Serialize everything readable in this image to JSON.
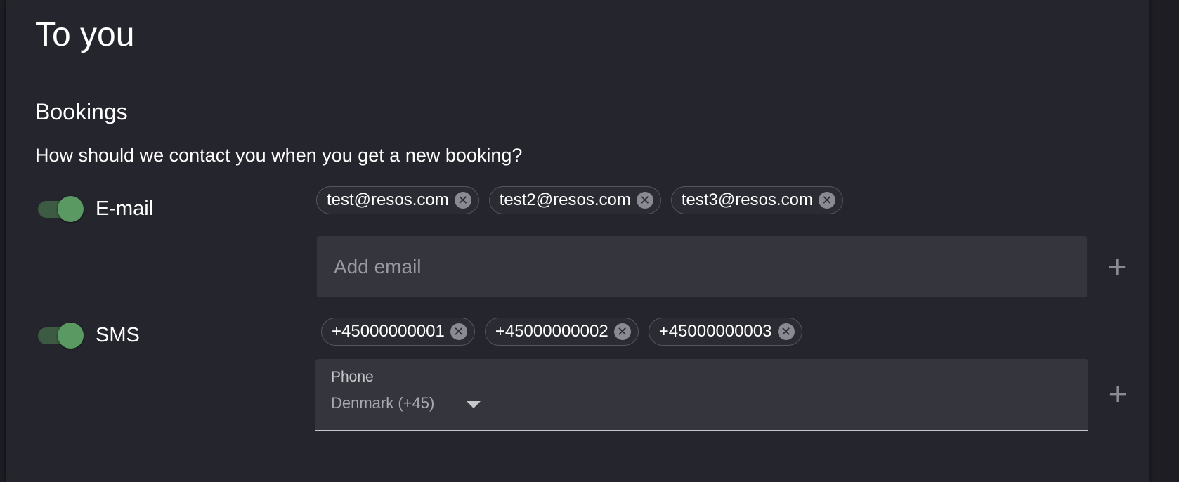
{
  "page": {
    "title": "To you"
  },
  "bookings": {
    "section_title": "Bookings",
    "question": "How should we contact you when you get a new booking?"
  },
  "email": {
    "label": "E-mail",
    "enabled": true,
    "chips": [
      "test@resos.com",
      "test2@resos.com",
      "test3@resos.com"
    ],
    "input_placeholder": "Add email",
    "add_label": "+"
  },
  "sms": {
    "label": "SMS",
    "enabled": true,
    "chips": [
      "+45000000001",
      "+45000000002",
      "+45000000003"
    ],
    "phone_label": "Phone",
    "country_value": "Denmark (+45)",
    "add_label": "+"
  },
  "icons": {
    "chip_remove": "close-circle-icon",
    "add": "plus-icon",
    "dropdown": "caret-down-icon"
  },
  "colors": {
    "background": "#1d1d23",
    "panel": "#25252d",
    "toggle_on_thumb": "#5a9a62",
    "toggle_on_track": "#3d5a42",
    "field": "#35353e"
  }
}
